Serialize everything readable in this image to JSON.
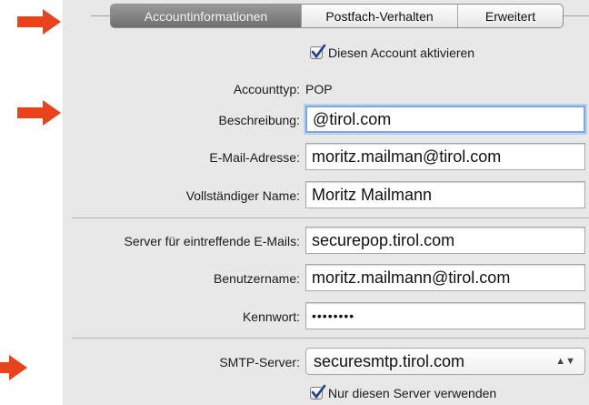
{
  "tabs": [
    {
      "label": "Accountinformationen",
      "active": true
    },
    {
      "label": "Postfach-Verhalten",
      "active": false
    },
    {
      "label": "Erweitert",
      "active": false
    }
  ],
  "account": {
    "activate_label": "Diesen Account aktivieren",
    "activate_checked": true,
    "type_label": "Accounttyp:",
    "type_value": "POP",
    "description_label": "Beschreibung:",
    "description_value": "@tirol.com",
    "email_label": "E-Mail-Adresse:",
    "email_value": "moritz.mailman@tirol.com",
    "fullname_label": "Vollständiger Name:",
    "fullname_value": "Moritz Mailmann"
  },
  "incoming": {
    "server_label": "Server für eintreffende E-Mails:",
    "server_value": "securepop.tirol.com",
    "username_label": "Benutzername:",
    "username_value": "moritz.mailmann@tirol.com",
    "password_label": "Kennwort:",
    "password_value": "••••••••"
  },
  "outgoing": {
    "smtp_label": "SMTP-Server:",
    "smtp_value": "securesmtp.tirol.com",
    "only_this_server_label": "Nur diesen Server verwenden",
    "only_this_server_checked": true
  },
  "colors": {
    "arrow": "#e8431c",
    "panel": "#e8e8e8",
    "focus_ring": "#7fa7dd",
    "checkmark": "#1b3f8f"
  }
}
